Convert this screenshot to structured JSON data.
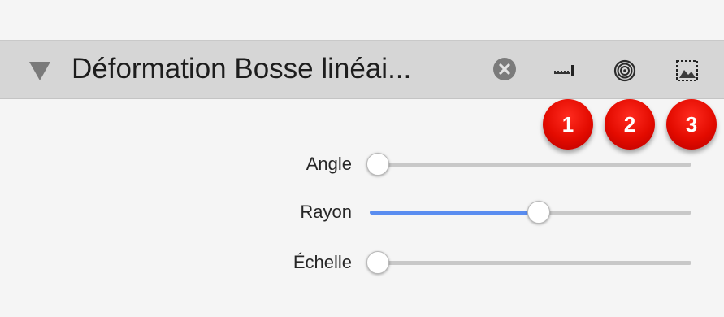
{
  "header": {
    "title": "Déformation Bosse linéai...",
    "icons": [
      "disclosure-triangle-icon",
      "close-circle-icon",
      "ruler-icon",
      "concentric-circles-icon",
      "image-selection-icon"
    ]
  },
  "badges": [
    "1",
    "2",
    "3"
  ],
  "sliders": [
    {
      "label": "Angle",
      "value_fraction": 0.0
    },
    {
      "label": "Rayon",
      "value_fraction": 0.5
    },
    {
      "label": "Échelle",
      "value_fraction": 0.0
    }
  ],
  "colors": {
    "header_bg": "#d6d6d6",
    "panel_bg": "#f5f5f5",
    "badge_red": "#e30b00",
    "slider_fill": "#5a8df0",
    "slider_track": "#c8c8c8"
  }
}
